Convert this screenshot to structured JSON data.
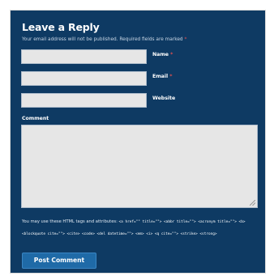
{
  "form": {
    "title": "Leave a Reply",
    "notice": "Your email address will not be published. Required fields are marked",
    "required_marker": "*",
    "fields": [
      {
        "label": "Name",
        "value": "",
        "required": true
      },
      {
        "label": "Email",
        "value": "",
        "required": true
      },
      {
        "label": "Website",
        "value": "",
        "required": false
      }
    ],
    "comment_label": "Comment",
    "comment_value": "",
    "tags_intro": "You may use these HTML tags and attributes:",
    "tags_code": "<a href=\"\" title=\"\"> <abbr title=\"\"> <acronym title=\"\"> <b> <blockquote cite=\"\"> <cite> <code> <del datetime=\"\"> <em> <i> <q cite=\"\"> <strike> <strong>",
    "submit_label": "Post Comment"
  },
  "colors": {
    "panel_background": "#0e3a63",
    "input_background": "#e6e6e6",
    "button_background": "#1f6aa7",
    "required_marker": "#e05050"
  }
}
